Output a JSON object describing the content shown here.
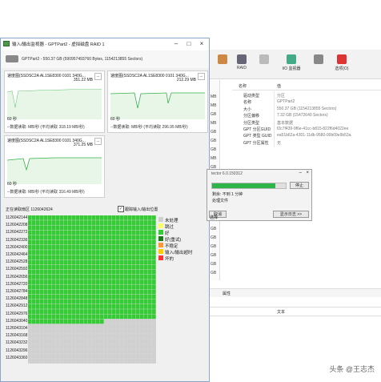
{
  "window": {
    "title": "输入/输出监视器 - GPTPart2 - 虚拟磁盘 RAID 1"
  },
  "disk": {
    "label": "GPTPart2 - 550.37 GB (590957493760 Bytes, 1154213855 Sectors)"
  },
  "graphs": [
    {
      "header": "速度图(SSDSC2A AL1SE8300 0101    340G...",
      "max": "351.22 MB",
      "min_label": "60 秒",
      "footer": "--数据读取: MB/秒 (平均读取 318.19 MB/秒)",
      "menu": "..."
    },
    {
      "header": "速度图(SSDSC2A AL1SE8300 0101    340G...",
      "max": "212.29 MB",
      "min_label": "60 秒",
      "footer": "--数据读取: MB/秒 (平均读取 296.95 MB/秒)",
      "menu": "..."
    },
    {
      "header": "速度图(SSDSC2A AL1SE8300 0101    340G...",
      "max": "371.25 MB",
      "min_label": "60 秒",
      "footer": "--数据读取: MB/秒 (平均读取 316.49 MB/秒)",
      "menu": "..."
    }
  ],
  "current_read": "正在读取扇区 1126042624",
  "follow_io": "跟踪输入/输出位置",
  "addresses": [
    "1126042144",
    "1126042208",
    "1126042272",
    "1126042336",
    "1126042400",
    "1126042464",
    "1126042528",
    "1126042592",
    "1126042656",
    "1126042720",
    "1126042784",
    "1126042848",
    "1126042912",
    "1126042976",
    "1126043040",
    "1126043104",
    "1126043168",
    "1126043232",
    "1126043296",
    "1126043360"
  ],
  "map_progress": 0.72,
  "legend": [
    {
      "label": "未处理",
      "color": "#d0d0d0"
    },
    {
      "label": "跳过",
      "color": "#ffff66"
    },
    {
      "label": "好",
      "color": "#33cc33"
    },
    {
      "label": "好(重试)",
      "color": "#1a7a1a"
    },
    {
      "label": "不稳定",
      "color": "#ff9933"
    },
    {
      "label": "输入/输出超时",
      "color": "#ffcc00"
    },
    {
      "label": "坏的",
      "color": "#ff3333"
    }
  ],
  "toolbar": {
    "items": [
      "",
      "RAID",
      "",
      "I/O 监视器",
      "",
      "选项(O)"
    ]
  },
  "left_items": [
    "MB",
    "MB",
    "GB",
    "MB",
    "GB",
    "GB",
    "GB",
    "MB",
    "GB",
    "MB",
    "MB",
    "GB",
    "GB",
    "GB",
    "GB",
    "GB",
    "GB",
    "GB",
    "GB",
    "GB",
    "GB"
  ],
  "props": {
    "col_name": "名称",
    "col_value": "值",
    "rows": [
      {
        "k": "驱动类型",
        "v": "分区"
      },
      {
        "k": "名称",
        "v": "GPTPart2"
      },
      {
        "k": "大小",
        "v": "550.37 GB (1154213855 Sectors)"
      },
      {
        "k": "分区偏移",
        "v": "7.32 GB (15472640 Sectors)"
      },
      {
        "k": "分区类型",
        "v": "基本数据"
      },
      {
        "k": "GPT 分区GUID",
        "v": "f2c7f439-9f6e-41cc-b815-822f6d4022ee"
      },
      {
        "k": "GPT 类型 GUID",
        "v": "ea51b62a-4301-11db-9580-00b09e9b53a"
      },
      {
        "k": "GPT 分区属性",
        "v": "无"
      }
    ]
  },
  "dialog": {
    "title": "tector 6.0.150312",
    "remaining": "剩余: 不到 1 分钟",
    "status": "处理文件",
    "stop": "停止",
    "cancel": "取消",
    "show_log": "显示日志 >>",
    "sel": "选择",
    "progress": 0.86
  },
  "bottom": {
    "props_tab": "属性",
    "text_header": "文本"
  },
  "watermark": "头条 @王志杰"
}
